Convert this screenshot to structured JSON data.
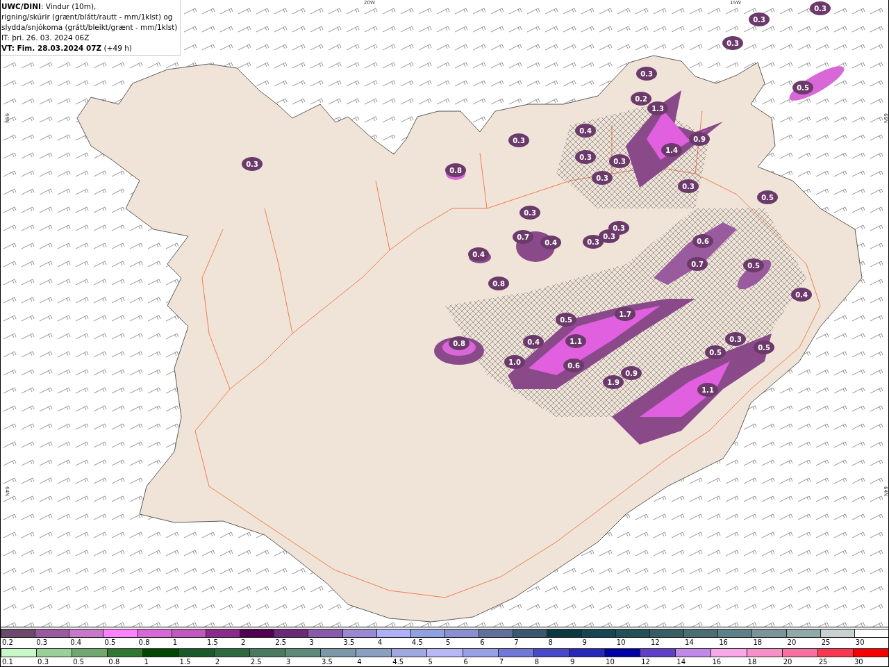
{
  "title_box": {
    "lines": [
      "**UWC/DINI**: Vindur (10m),",
      "rigning/skúrir (grænt/blátt/rautt - mm/1klst) og",
      "slydda/snjókoma (grátt/bleikt/grænt - mm/1klst)",
      "IT: þri. 26. 03. 2024 06Z",
      "**VT: Fim. 28.03.2024 07Z** (+49 h)"
    ]
  },
  "map": {
    "grid_labels": [
      {
        "kind": "top",
        "text": "20W"
      },
      {
        "kind": "top",
        "text": "15W"
      },
      {
        "kind": "left",
        "text": "66N"
      },
      {
        "kind": "left",
        "text": "64N"
      },
      {
        "kind": "right",
        "text": "66N"
      },
      {
        "kind": "right",
        "text": "64N"
      }
    ],
    "precip_values": [
      "0.3",
      "0.2",
      "1.3",
      "0.4",
      "0.3",
      "0.3",
      "0.8",
      "1.4",
      "0.9",
      "0.3",
      "0.3",
      "0.3",
      "0.3",
      "0.5",
      "0.3",
      "0.7",
      "0.4",
      "0.3",
      "0.3",
      "0.3",
      "0.6",
      "0.7",
      "0.5",
      "0.4",
      "0.8",
      "0.4",
      "0.5",
      "1.7",
      "0.8",
      "0.4",
      "1.1",
      "1.0",
      "0.6",
      "1.9",
      "0.9",
      "1.1",
      "0.5",
      "0.3",
      "0.5",
      "0.3",
      "0.3",
      "0.3",
      "0.5"
    ]
  },
  "legend": {
    "rows": [
      {
        "swatches": [
          {
            "label": "0.2",
            "color": "#6b4a6b"
          },
          {
            "label": "0.3",
            "color": "#9a5a9e"
          },
          {
            "label": "0.4",
            "color": "#c878c8"
          },
          {
            "label": "0.5",
            "color": "#ff80ff"
          },
          {
            "label": "0.8",
            "color": "#d868d8"
          },
          {
            "label": "1",
            "color": "#c058c0"
          },
          {
            "label": "1.5",
            "color": "#8a2a8a"
          },
          {
            "label": "2",
            "color": "#500050"
          },
          {
            "label": "2.5",
            "color": "#6a2a78"
          },
          {
            "label": "3",
            "color": "#8a5aaa"
          },
          {
            "label": "3.5",
            "color": "#9a88d0"
          },
          {
            "label": "4",
            "color": "#b0b0f8"
          },
          {
            "label": "4.5",
            "color": "#90a0e0"
          },
          {
            "label": "5",
            "color": "#8890d0"
          },
          {
            "label": "6",
            "color": "#60709a"
          },
          {
            "label": "7",
            "color": "#3a5870"
          },
          {
            "label": "8",
            "color": "#0a3a40"
          },
          {
            "label": "9",
            "color": "#164650"
          },
          {
            "label": "10",
            "color": "#245058"
          },
          {
            "label": "12",
            "color": "#365e64"
          },
          {
            "label": "14",
            "color": "#4a6e74"
          },
          {
            "label": "16",
            "color": "#5e8088"
          },
          {
            "label": "18",
            "color": "#7a9498"
          },
          {
            "label": "20",
            "color": "#90a8a8"
          },
          {
            "label": "25",
            "color": "#c8d0d0"
          },
          {
            "label": "30",
            "color": "#ffffff"
          }
        ]
      },
      {
        "swatches": [
          {
            "label": "0.1",
            "color": "#c8f8c8"
          },
          {
            "label": "0.3",
            "color": "#98d098"
          },
          {
            "label": "0.5",
            "color": "#70a870"
          },
          {
            "label": "0.8",
            "color": "#307830"
          },
          {
            "label": "1",
            "color": "#004800"
          },
          {
            "label": "1.5",
            "color": "#1a5a2a"
          },
          {
            "label": "2",
            "color": "#2e6a40"
          },
          {
            "label": "2.5",
            "color": "#4a7a60"
          },
          {
            "label": "3",
            "color": "#5e8a7a"
          },
          {
            "label": "3.5",
            "color": "#7a98a8"
          },
          {
            "label": "4",
            "color": "#8aa0c0"
          },
          {
            "label": "4.5",
            "color": "#a0a8e0"
          },
          {
            "label": "5",
            "color": "#b8b8f8"
          },
          {
            "label": "6",
            "color": "#98a0e8"
          },
          {
            "label": "7",
            "color": "#7078d8"
          },
          {
            "label": "8",
            "color": "#4848c8"
          },
          {
            "label": "9",
            "color": "#2828b8"
          },
          {
            "label": "10",
            "color": "#0000a8"
          },
          {
            "label": "12",
            "color": "#6040c8"
          },
          {
            "label": "14",
            "color": "#c088e8"
          },
          {
            "label": "16",
            "color": "#f8a8e8"
          },
          {
            "label": "18",
            "color": "#f890c8"
          },
          {
            "label": "20",
            "color": "#f870a0"
          },
          {
            "label": "25",
            "color": "#f83850"
          },
          {
            "label": "30",
            "color": "#f80000"
          }
        ]
      }
    ]
  }
}
